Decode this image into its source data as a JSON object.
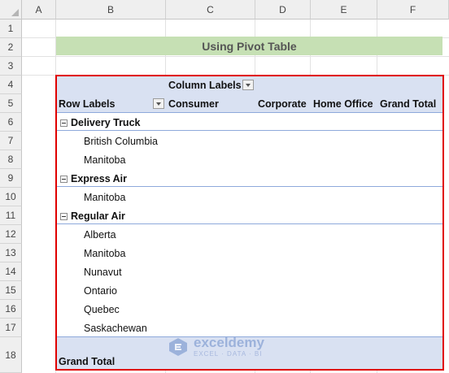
{
  "columns": [
    "A",
    "B",
    "C",
    "D",
    "E",
    "F"
  ],
  "rows": [
    "1",
    "2",
    "3",
    "4",
    "5",
    "6",
    "7",
    "8",
    "9",
    "10",
    "11",
    "12",
    "13",
    "14",
    "15",
    "16",
    "17",
    "18"
  ],
  "title": "Using Pivot Table",
  "pivot": {
    "column_labels": "Column Labels",
    "row_labels": "Row Labels",
    "headers": [
      "Consumer",
      "Corporate",
      "Home Office",
      "Grand Total"
    ],
    "groups": [
      {
        "name": "Delivery Truck",
        "items": [
          "British Columbia",
          "Manitoba"
        ]
      },
      {
        "name": "Express Air",
        "items": [
          "Manitoba"
        ]
      },
      {
        "name": "Regular Air",
        "items": [
          "Alberta",
          "Manitoba",
          "Nunavut",
          "Ontario",
          "Quebec",
          "Saskachewan"
        ]
      }
    ],
    "grand_total": "Grand Total"
  },
  "watermark": {
    "name": "exceldemy",
    "tagline": "EXCEL · DATA · BI"
  },
  "colors": {
    "title_fill": "#c6e0b4",
    "pivot_band": "#d9e1f2",
    "highlight_border": "#e00000"
  },
  "icons": [
    "filter-dropdown-icon",
    "collapse-minus-icon",
    "exceldemy-logo-icon"
  ]
}
